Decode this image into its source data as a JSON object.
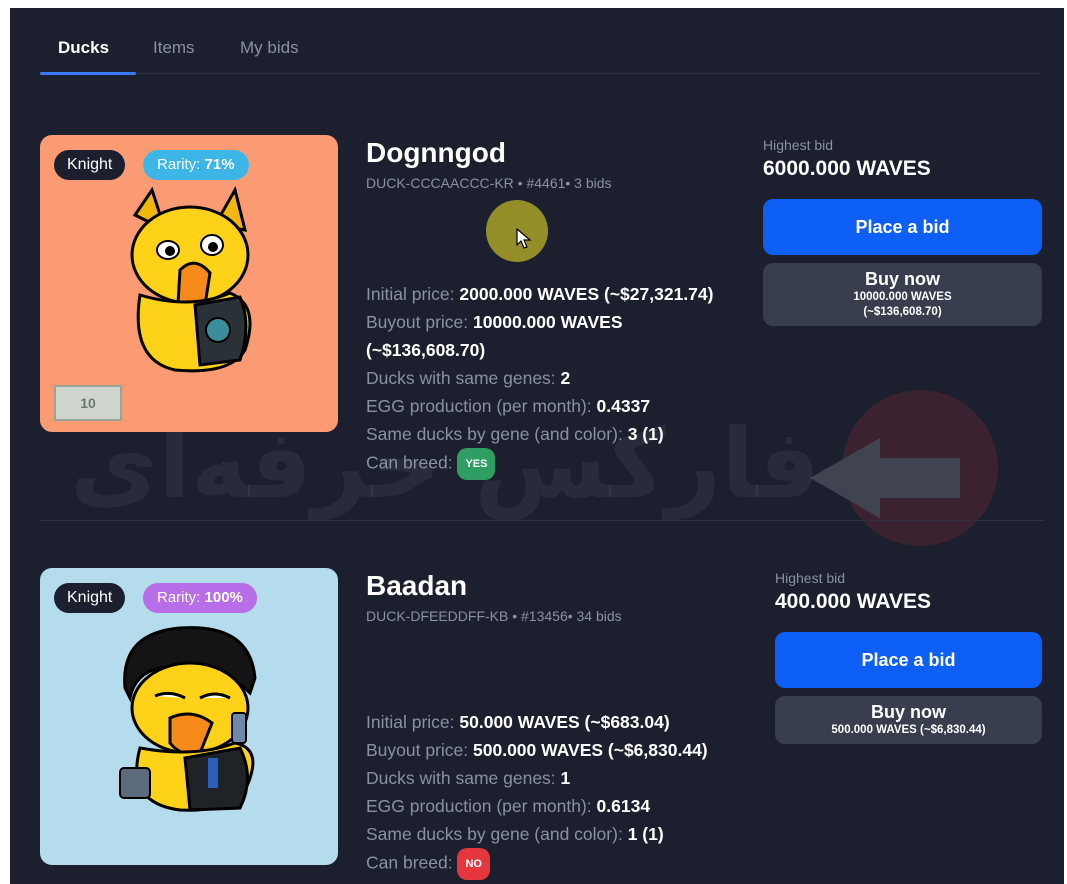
{
  "tabs": [
    {
      "label": "Ducks",
      "active": true
    },
    {
      "label": "Items",
      "active": false
    },
    {
      "label": "My bids",
      "active": false
    }
  ],
  "listings": [
    {
      "name": "Dognngod",
      "class_badge": "Knight",
      "rarity_label": "Rarity:",
      "rarity_value": "71%",
      "subtitle": "DUCK-CCCAACCC-KR • #4461• 3 bids",
      "details": {
        "initial_label": "Initial price:",
        "initial_value": "2000.000 WAVES (~$27,321.74)",
        "buyout_label": "Buyout price:",
        "buyout_value_1": "10000.000 WAVES",
        "buyout_value_2": "(~$136,608.70)",
        "genes_label": "Ducks with same genes:",
        "genes_value": "2",
        "egg_label": "EGG production (per month):",
        "egg_value": "0.4337",
        "same_label": "Same ducks by gene (and color):",
        "same_value": "3 (1)",
        "breed_label": "Can breed:",
        "breed_value": "YES"
      },
      "highest_bid_label": "Highest bid",
      "highest_bid_value": "6000.000 WAVES",
      "bid_button": "Place a bid",
      "buy_button": "Buy now",
      "buy_price_1": "10000.000 WAVES",
      "buy_price_2": "(~$136,608.70)",
      "banknote_text": "10"
    },
    {
      "name": "Baadan",
      "class_badge": "Knight",
      "rarity_label": "Rarity:",
      "rarity_value": "100%",
      "subtitle": "DUCK-DFEEDDFF-KB • #13456• 34 bids",
      "details": {
        "initial_label": "Initial price:",
        "initial_value": "50.000 WAVES (~$683.04)",
        "buyout_label": "Buyout price:",
        "buyout_value_1": "500.000 WAVES (~$6,830.44)",
        "genes_label": "Ducks with same genes:",
        "genes_value": "1",
        "egg_label": "EGG production (per month):",
        "egg_value": "0.6134",
        "same_label": "Same ducks by gene (and color):",
        "same_value": "1 (1)",
        "breed_label": "Can breed:",
        "breed_value": "NO"
      },
      "highest_bid_label": "Highest bid",
      "highest_bid_value": "400.000 WAVES",
      "bid_button": "Place a bid",
      "buy_button": "Buy now",
      "buy_price_1": "500.000 WAVES (~$6,830.44)"
    }
  ],
  "watermark": "فارکس حرفه‌ای",
  "colors": {
    "background": "#1b1f2e",
    "accent": "#0d5ff5",
    "card_1": "#fb9b74",
    "card_2": "#b4dced",
    "yes": "#2f9e62",
    "no": "#e4373d"
  }
}
